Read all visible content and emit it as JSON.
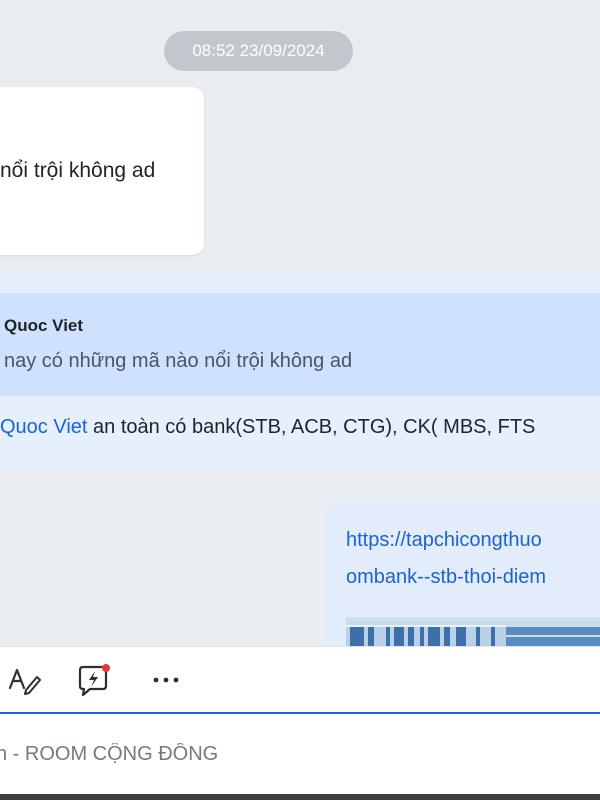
{
  "chat": {
    "timestamp": "08:52 23/09/2024",
    "incoming_message": {
      "text": "nổi trội không ad"
    },
    "reply_message": {
      "quote_author": "Quoc Viet",
      "quote_text": "nay có những mã nào nổi trội không ad",
      "mention": "Quoc Viet",
      "body": " an toàn có bank(STB, ACB, CTG), CK( MBS, FTS"
    },
    "outgoing_message": {
      "link_line_1": "https://tapchicongthuo",
      "link_line_2": "ombank--stb-thoi-diem"
    }
  },
  "toolbar": {
    "icons": [
      "text-format-icon",
      "quick-message-icon",
      "more-icon"
    ],
    "quick_message_badge_color": "#e53935"
  },
  "composer": {
    "placeholder": "n - ROOM CỘNG ĐỒNG",
    "value": ""
  },
  "colors": {
    "accent": "#1a62d6",
    "quote_background": "#cfe2fd",
    "reply_background": "#e6effc"
  }
}
